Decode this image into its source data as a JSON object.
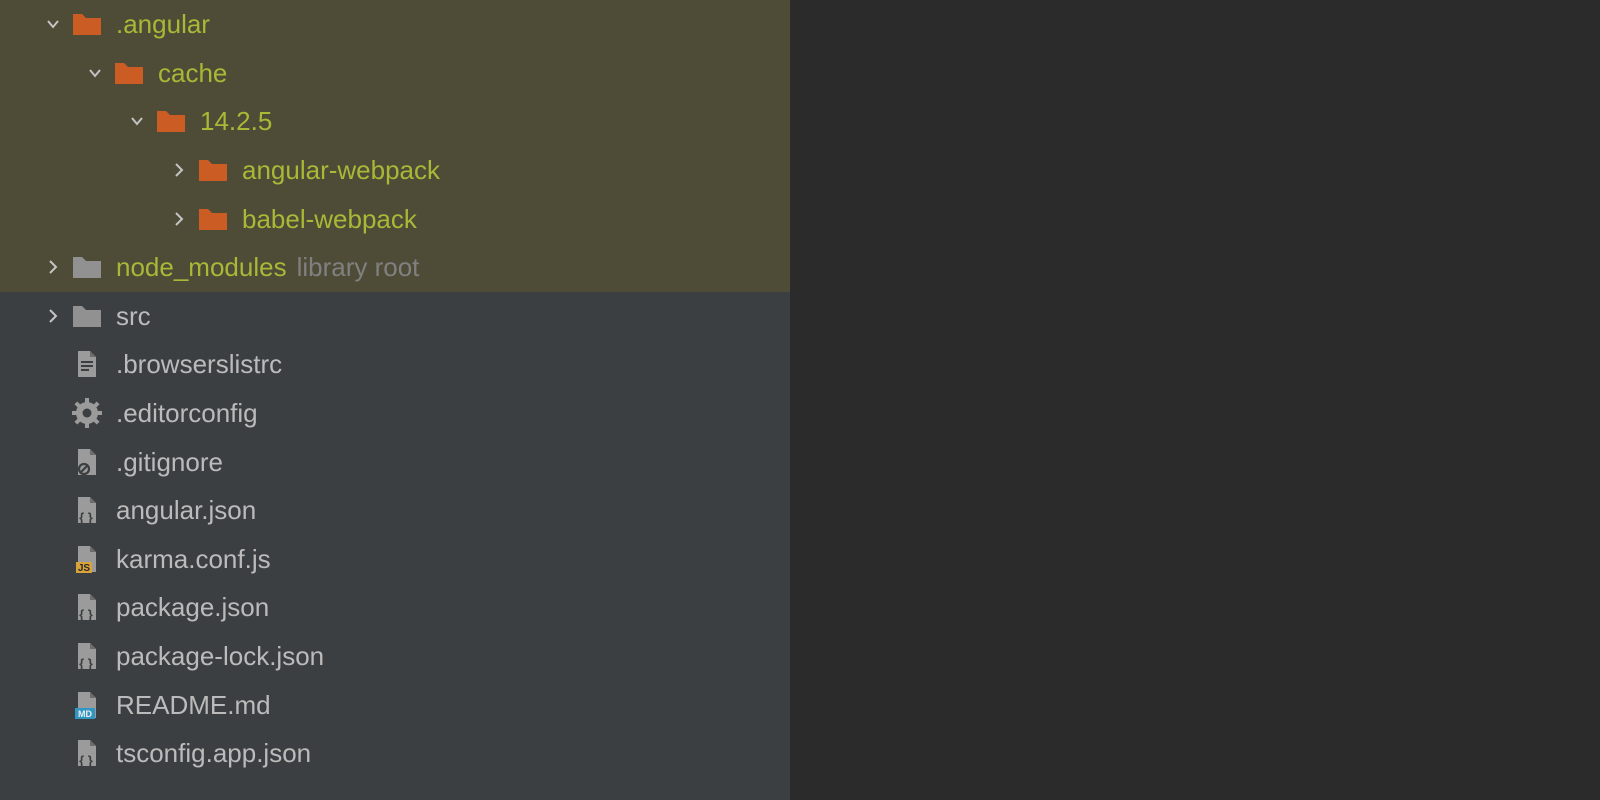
{
  "tree": {
    "items": [
      {
        "id": "angular",
        "depth": 0,
        "arrow": "down",
        "icon": "folder-ex",
        "label": ".angular",
        "excluded": true
      },
      {
        "id": "cache",
        "depth": 1,
        "arrow": "down",
        "icon": "folder-ex",
        "label": "cache",
        "excluded": true
      },
      {
        "id": "v14-2-5",
        "depth": 2,
        "arrow": "down",
        "icon": "folder-ex",
        "label": "14.2.5",
        "excluded": true
      },
      {
        "id": "angular-webpack",
        "depth": 3,
        "arrow": "right",
        "icon": "folder-ex",
        "label": "angular-webpack",
        "excluded": true
      },
      {
        "id": "babel-webpack",
        "depth": 3,
        "arrow": "right",
        "icon": "folder-ex",
        "label": "babel-webpack",
        "excluded": true
      },
      {
        "id": "node-modules",
        "depth": 0,
        "arrow": "right",
        "icon": "folder-norm",
        "label": "node_modules",
        "excluded": true,
        "suffix": "library root"
      },
      {
        "id": "src",
        "depth": 0,
        "arrow": "right",
        "icon": "folder-norm",
        "label": "src"
      },
      {
        "id": "browserslistrc",
        "depth": 0,
        "arrow": "none",
        "icon": "text",
        "label": ".browserslistrc"
      },
      {
        "id": "editorconfig",
        "depth": 0,
        "arrow": "none",
        "icon": "gear",
        "label": ".editorconfig"
      },
      {
        "id": "gitignore",
        "depth": 0,
        "arrow": "none",
        "icon": "ignore",
        "label": ".gitignore"
      },
      {
        "id": "angular-json",
        "depth": 0,
        "arrow": "none",
        "icon": "json",
        "label": "angular.json"
      },
      {
        "id": "karma-conf",
        "depth": 0,
        "arrow": "none",
        "icon": "js",
        "label": "karma.conf.js"
      },
      {
        "id": "package-json",
        "depth": 0,
        "arrow": "none",
        "icon": "json",
        "label": "package.json"
      },
      {
        "id": "package-lock",
        "depth": 0,
        "arrow": "none",
        "icon": "json",
        "label": "package-lock.json"
      },
      {
        "id": "readme",
        "depth": 0,
        "arrow": "none",
        "icon": "md",
        "label": "README.md"
      },
      {
        "id": "tsconfig-app",
        "depth": 0,
        "arrow": "none",
        "icon": "json",
        "label": "tsconfig.app.json"
      }
    ]
  }
}
